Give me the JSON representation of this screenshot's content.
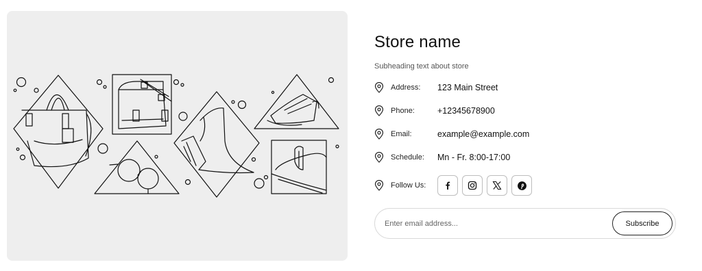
{
  "store": {
    "title": "Store name",
    "subheading": "Subheading text about store"
  },
  "contact": {
    "address_label": "Address:",
    "address_value": "123 Main Street",
    "phone_label": "Phone:",
    "phone_value": "+12345678900",
    "email_label": "Email:",
    "email_value": "example@example.com",
    "schedule_label": "Schedule:",
    "schedule_value": "Mn - Fr. 8:00-17:00",
    "follow_label": "Follow Us:"
  },
  "socials": [
    {
      "icon": "facebook-icon"
    },
    {
      "icon": "instagram-icon"
    },
    {
      "icon": "x-icon"
    },
    {
      "icon": "pinterest-icon"
    }
  ],
  "newsletter": {
    "placeholder": "Enter email address...",
    "button_label": "Subscribe"
  },
  "colors": {
    "hero_background": "#eeeeee",
    "text": "#111111",
    "border": "#d9d9d9"
  }
}
